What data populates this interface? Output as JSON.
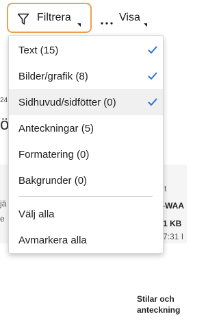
{
  "toolbar": {
    "filter_label": "Filtrera",
    "show_label": "Visa"
  },
  "background": {
    "date_fragment": "24",
    "heading_fragment": "ör",
    "row_fragment_1": "jä",
    "row_fragment_2": "e",
    "col_fragment_t": "t",
    "filename_fragment": "-WAA",
    "size_fragment": "1 KB",
    "time_fragment": "7:31 I",
    "card_line_1": "Stilar och",
    "card_line_2": "anteckning"
  },
  "menu": {
    "items": [
      {
        "label": "Text (15)",
        "checked": true
      },
      {
        "label": "Bilder/grafik (8)",
        "checked": true
      },
      {
        "label": "Sidhuvud/sidfötter (0)",
        "checked": true
      },
      {
        "label": "Anteckningar (5)",
        "checked": false
      },
      {
        "label": "Formatering (0)",
        "checked": false
      },
      {
        "label": "Bakgrunder (0)",
        "checked": false
      }
    ],
    "actions": [
      {
        "label": "Välj alla"
      },
      {
        "label": "Avmarkera alla"
      }
    ]
  },
  "colors": {
    "focus_border": "#f0a04b",
    "check": "#2b6fd6",
    "hover_bg": "#f0f0f0"
  }
}
